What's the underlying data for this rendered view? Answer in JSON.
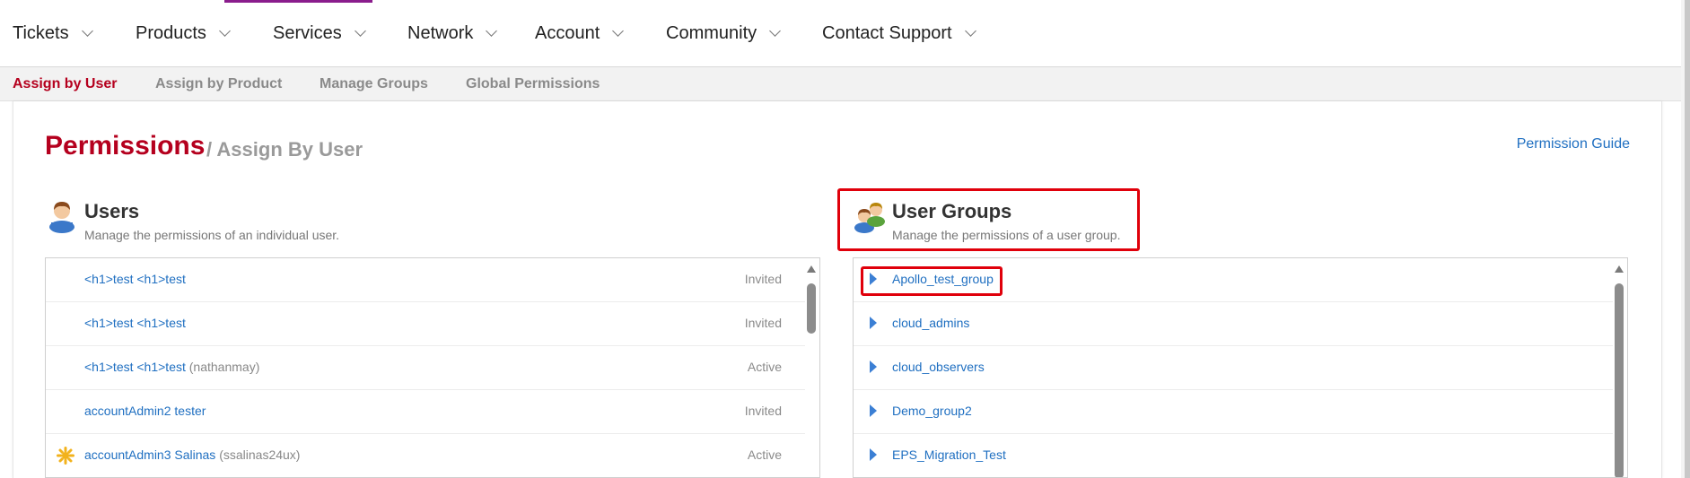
{
  "topnav": {
    "items": [
      {
        "label": "Tickets"
      },
      {
        "label": "Products"
      },
      {
        "label": "Services"
      },
      {
        "label": "Network"
      },
      {
        "label": "Account"
      },
      {
        "label": "Community"
      },
      {
        "label": "Contact Support"
      }
    ]
  },
  "subnav": {
    "items": [
      {
        "label": "Assign by User",
        "active": true
      },
      {
        "label": "Assign by Product"
      },
      {
        "label": "Manage Groups"
      },
      {
        "label": "Global Permissions"
      }
    ]
  },
  "page": {
    "title": "Permissions",
    "subtitle": "/ Assign By User",
    "guide_link": "Permission Guide"
  },
  "users": {
    "title": "Users",
    "description": "Manage the permissions of an individual user.",
    "rows": [
      {
        "name": "<h1>test <h1>test",
        "username": "",
        "status": "Invited",
        "icon": ""
      },
      {
        "name": "<h1>test <h1>test",
        "username": "",
        "status": "Invited",
        "icon": ""
      },
      {
        "name": "<h1>test <h1>test",
        "username": "(nathanmay)",
        "status": "Active",
        "icon": ""
      },
      {
        "name": "accountAdmin2 tester",
        "username": "",
        "status": "Invited",
        "icon": ""
      },
      {
        "name": "accountAdmin3 Salinas",
        "username": "(ssalinas24ux)",
        "status": "Active",
        "icon": "admin-star-icon"
      }
    ]
  },
  "groups": {
    "title": "User Groups",
    "description": "Manage the permissions of a user group.",
    "rows": [
      {
        "name": "Apollo_test_group"
      },
      {
        "name": "cloud_admins"
      },
      {
        "name": "cloud_observers"
      },
      {
        "name": "Demo_group2"
      },
      {
        "name": "EPS_Migration_Test"
      }
    ]
  },
  "colors": {
    "brand_red": "#b5001e",
    "link_blue": "#1f6fc1",
    "highlight_red": "#e0000b",
    "nav_accent": "#8a1c8c"
  }
}
